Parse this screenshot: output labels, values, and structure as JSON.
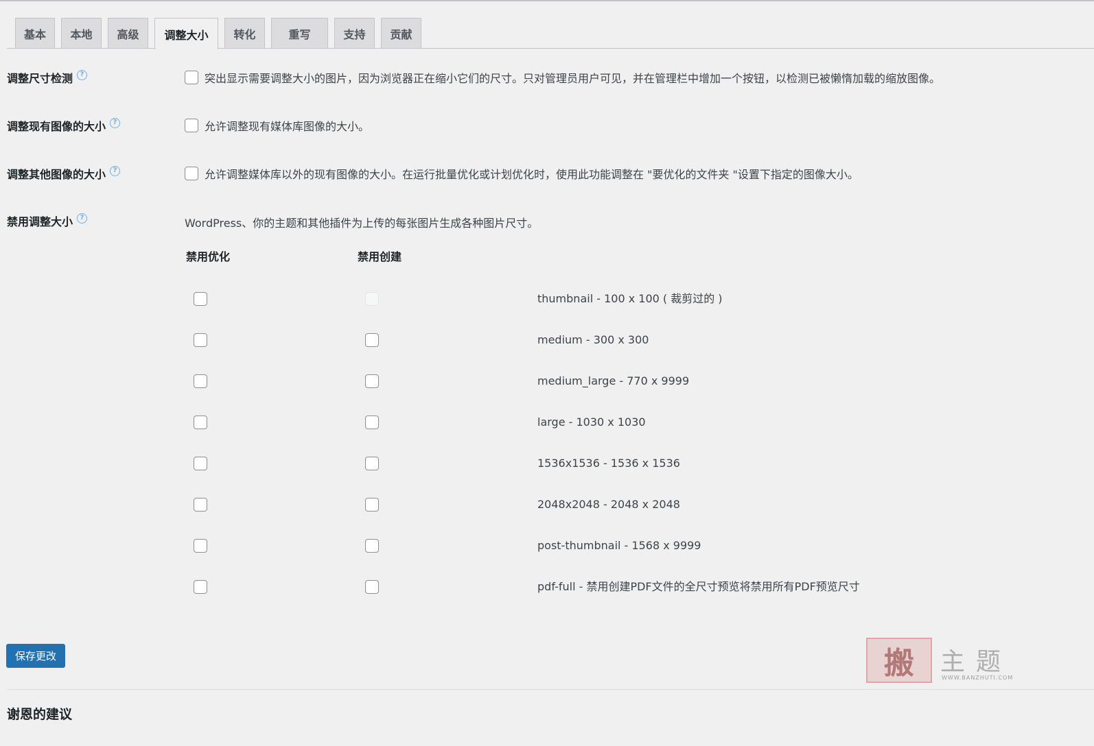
{
  "tabs": [
    {
      "label": "基本",
      "active": false
    },
    {
      "label": "本地",
      "active": false
    },
    {
      "label": "高级",
      "active": false
    },
    {
      "label": "调整大小",
      "active": true
    },
    {
      "label": "转化",
      "active": false
    },
    {
      "label": "重写",
      "active": false
    },
    {
      "label": "支持",
      "active": false
    },
    {
      "label": "贡献",
      "active": false
    }
  ],
  "settings": {
    "resize_detection": {
      "label": "调整尺寸检测",
      "option": "突出显示需要调整大小的图片，因为浏览器正在缩小它们的尺寸。只对管理员用户可见，并在管理栏中增加一个按钮，以检测已被懒惰加载的缩放图像。",
      "checked": false
    },
    "resize_existing": {
      "label": "调整现有图像的大小",
      "option": "允许调整现有媒体库图像的大小。",
      "checked": false
    },
    "resize_other": {
      "label": "调整其他图像的大小",
      "option": "允许调整媒体库以外的现有图像的大小。在运行批量优化或计划优化时，使用此功能调整在 \"要优化的文件夹 \"设置下指定的图像大小。",
      "checked": false
    },
    "disable_resizes": {
      "label": "禁用调整大小",
      "description": "WordPress、你的主题和其他插件为上传的每张图片生成各种图片尺寸。",
      "col_disable_optimization": "禁用优化",
      "col_disable_creation": "禁用创建",
      "sizes": [
        {
          "text": "thumbnail - 100 x 100 ( 裁剪过的 )",
          "opt": false,
          "create": false,
          "create_disabled": true
        },
        {
          "text": "medium - 300 x 300",
          "opt": false,
          "create": false,
          "create_disabled": false
        },
        {
          "text": "medium_large - 770 x 9999",
          "opt": false,
          "create": false,
          "create_disabled": false
        },
        {
          "text": "large - 1030 x 1030",
          "opt": false,
          "create": false,
          "create_disabled": false
        },
        {
          "text": "1536x1536 - 1536 x 1536",
          "opt": false,
          "create": false,
          "create_disabled": false
        },
        {
          "text": "2048x2048 - 2048 x 2048",
          "opt": false,
          "create": false,
          "create_disabled": false
        },
        {
          "text": "post-thumbnail - 1568 x 9999",
          "opt": false,
          "create": false,
          "create_disabled": false
        },
        {
          "text": "pdf-full - 禁用创建PDF文件的全尺寸预览将禁用所有PDF预览尺寸",
          "opt": false,
          "create": false,
          "create_disabled": false
        }
      ]
    }
  },
  "save_button": "保存更改",
  "footer_title": "谢恩的建议",
  "help_glyph": "?",
  "watermark": {
    "logo": "搬",
    "text": "主题",
    "url": "WWW.BANZHUTI.COM"
  },
  "colors": {
    "primary": "#2271b1",
    "background": "#f0f0f1",
    "help": "#72aee6"
  }
}
